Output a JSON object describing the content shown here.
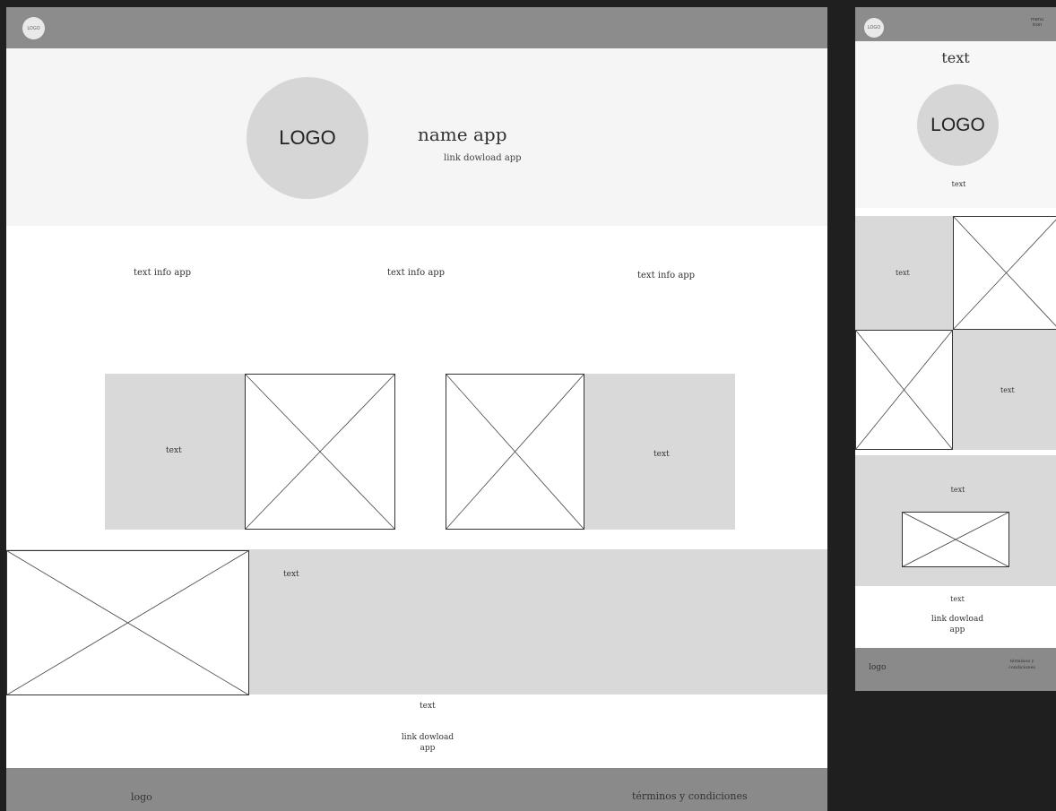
{
  "desktop": {
    "nav": {
      "logo_badge": "LOGO"
    },
    "hero": {
      "logo_label": "LOGO",
      "app_name": "name app",
      "download_link": "link dowload app"
    },
    "info_columns": [
      "text info app",
      "text info app",
      "text info app"
    ],
    "feature_left_text": "text",
    "feature_right_text": "text",
    "banner_text": "text",
    "bottom_text": "text",
    "bottom_link_line1": "link dowload",
    "bottom_link_line2": "app",
    "footer": {
      "logo": "logo",
      "terms": "términos y condiciones"
    }
  },
  "mobile": {
    "nav": {
      "logo_badge": "LOGO",
      "menu_icon_line1": "menu",
      "menu_icon_line2": "icon"
    },
    "hero": {
      "heading": "text",
      "logo_label": "LOGO",
      "caption": "text"
    },
    "row1_text": "text",
    "row2_text": "text",
    "panel_text": "text",
    "bottom_text": "text",
    "bottom_link_line1": "link dowload",
    "bottom_link_line2": "app",
    "footer": {
      "logo": "logo",
      "terms_line1": "términos y",
      "terms_line2": "condiciones"
    }
  },
  "colors": {
    "nav_bar": "#8c8c8c",
    "hero_bg": "#f5f5f5",
    "block_grey": "#d9d9d9",
    "logo_circle": "#d6d6d6",
    "canvas_bg": "#1f1f1f"
  }
}
